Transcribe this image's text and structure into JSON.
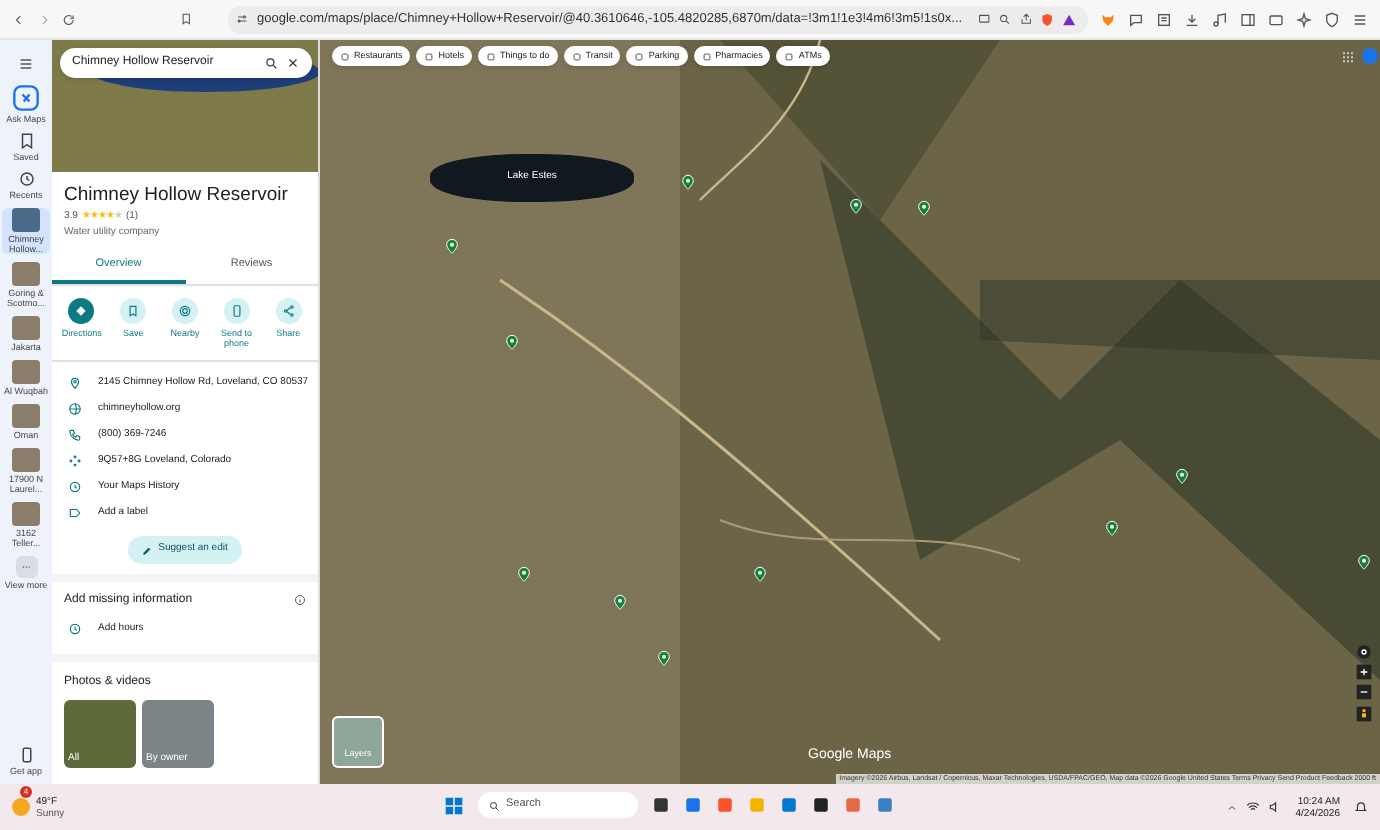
{
  "browser": {
    "url": "google.com/maps/place/Chimney+Hollow+Reservoir/@40.3610646,-105.4820285,6870m/data=!3m1!1e3!4m6!3m5!1s0x..."
  },
  "rail": [
    {
      "kind": "action",
      "label": "Ask Maps",
      "selected": false
    },
    {
      "kind": "saved",
      "label": "Saved",
      "selected": false
    },
    {
      "kind": "recents",
      "label": "Recents",
      "selected": false
    },
    {
      "kind": "place",
      "label": "Chimney Hollow...",
      "selected": true
    },
    {
      "kind": "place",
      "label": "Goring & Scotmo...",
      "selected": false
    },
    {
      "kind": "place",
      "label": "Jakarta",
      "selected": false
    },
    {
      "kind": "place",
      "label": "Al Wuqbah",
      "selected": false
    },
    {
      "kind": "place",
      "label": "Oman",
      "selected": false
    },
    {
      "kind": "place",
      "label": "17900 N Laurel...",
      "selected": false
    },
    {
      "kind": "place",
      "label": "3162 Teller...",
      "selected": false
    },
    {
      "kind": "more",
      "label": "View more",
      "selected": false
    },
    {
      "kind": "app",
      "label": "Get app",
      "selected": false
    }
  ],
  "panel": {
    "search_query": "Chimney Hollow Reservoir",
    "title": "Chimney Hollow Reservoir",
    "rating": "3.9",
    "stars": 4,
    "review_count": "(1)",
    "category": "Water utility company",
    "tabs": [
      {
        "label": "Overview",
        "selected": true
      },
      {
        "label": "Reviews",
        "selected": false
      }
    ],
    "actions": [
      {
        "kind": "directions",
        "label": "Directions"
      },
      {
        "kind": "save",
        "label": "Save"
      },
      {
        "kind": "nearby",
        "label": "Nearby"
      },
      {
        "kind": "phone",
        "label": "Send to phone"
      },
      {
        "kind": "share",
        "label": "Share"
      }
    ],
    "info_rows": [
      {
        "kind": "address",
        "text": "2145 Chimney Hollow Rd, Loveland, CO 80537"
      },
      {
        "kind": "website",
        "text": "chimneyhollow.org"
      },
      {
        "kind": "phone",
        "text": "(800) 369-7246"
      },
      {
        "kind": "pluscode",
        "text": "9Q57+8G Loveland, Colorado"
      },
      {
        "kind": "history",
        "text": "Your Maps History"
      },
      {
        "kind": "label",
        "text": "Add a label"
      }
    ],
    "suggest_edit": "Suggest an edit",
    "missing_info": {
      "heading": "Add missing information",
      "items": [
        "Add hours"
      ]
    },
    "photos": {
      "heading": "Photos & videos",
      "tiles": [
        "All",
        "By owner"
      ]
    }
  },
  "map": {
    "chips": [
      "Restaurants",
      "Hotels",
      "Things to do",
      "Transit",
      "Parking",
      "Pharmacies",
      "ATMs"
    ],
    "lake_label": "Lake Estes",
    "layers_label": "Layers",
    "logo": "Google Maps",
    "attribution": "Imagery ©2026 Airbus, Landsat / Copernicus, Maxar Technologies, USDA/FPAC/GEO, Map data ©2026 Google   United States   Terms   Privacy   Send Product Feedback   2000 ft"
  },
  "taskbar": {
    "weather": {
      "temp": "49°F",
      "condition": "Sunny",
      "badge": "4"
    },
    "search_placeholder": "Search",
    "time": "10:24 AM",
    "date": "4/24/2026"
  }
}
